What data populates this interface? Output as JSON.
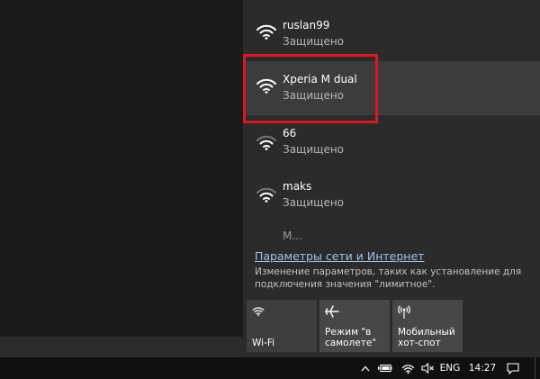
{
  "networks": [
    {
      "name": "ruslan99",
      "status": "Защищено"
    },
    {
      "name": "Xperia M dual",
      "status": "Защищено"
    },
    {
      "name": "66",
      "status": "Защищено"
    },
    {
      "name": "maks",
      "status": "Защищено"
    }
  ],
  "partial_network": {
    "name": "M..."
  },
  "settings": {
    "link": "Параметры сети и Интернет",
    "description": "Изменение параметров, таких как установление для подключения значения \"лимитное\"."
  },
  "quick_actions": [
    {
      "label": "Wi-Fi",
      "icon": "wifi-icon"
    },
    {
      "label": "Режим \"в\nсамолете\"",
      "icon": "airplane-icon"
    },
    {
      "label": "Мобильный\nхот-спот",
      "icon": "hotspot-icon"
    }
  ],
  "taskbar": {
    "language": "ENG",
    "time": "14:27"
  },
  "colors": {
    "highlight": "#e0161e",
    "link": "#9fc3ea",
    "flyout_bg": "#2b2b2b"
  }
}
